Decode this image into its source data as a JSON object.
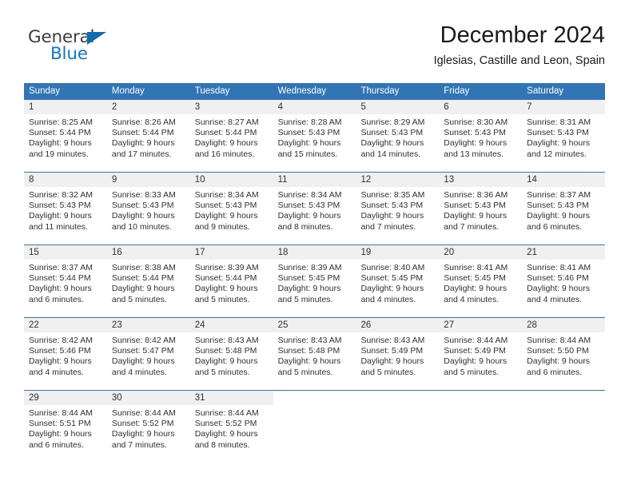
{
  "logo": {
    "word_top": "General",
    "word_bottom": "Blue",
    "triangle_color": "#0f6bb0",
    "top_color": "#3d3d3d",
    "bottom_color": "#1178c6"
  },
  "header": {
    "title": "December 2024",
    "subtitle": "Iglesias, Castille and Leon, Spain"
  },
  "theme": {
    "header_blue": "#3175b5",
    "day_band_gray": "#f0f0f0",
    "text": "#303030"
  },
  "weekdays": [
    "Sunday",
    "Monday",
    "Tuesday",
    "Wednesday",
    "Thursday",
    "Friday",
    "Saturday"
  ],
  "weeks": [
    [
      {
        "day": "1",
        "sunrise": "Sunrise: 8:25 AM",
        "sunset": "Sunset: 5:44 PM",
        "daylight1": "Daylight: 9 hours",
        "daylight2": "and 19 minutes."
      },
      {
        "day": "2",
        "sunrise": "Sunrise: 8:26 AM",
        "sunset": "Sunset: 5:44 PM",
        "daylight1": "Daylight: 9 hours",
        "daylight2": "and 17 minutes."
      },
      {
        "day": "3",
        "sunrise": "Sunrise: 8:27 AM",
        "sunset": "Sunset: 5:44 PM",
        "daylight1": "Daylight: 9 hours",
        "daylight2": "and 16 minutes."
      },
      {
        "day": "4",
        "sunrise": "Sunrise: 8:28 AM",
        "sunset": "Sunset: 5:43 PM",
        "daylight1": "Daylight: 9 hours",
        "daylight2": "and 15 minutes."
      },
      {
        "day": "5",
        "sunrise": "Sunrise: 8:29 AM",
        "sunset": "Sunset: 5:43 PM",
        "daylight1": "Daylight: 9 hours",
        "daylight2": "and 14 minutes."
      },
      {
        "day": "6",
        "sunrise": "Sunrise: 8:30 AM",
        "sunset": "Sunset: 5:43 PM",
        "daylight1": "Daylight: 9 hours",
        "daylight2": "and 13 minutes."
      },
      {
        "day": "7",
        "sunrise": "Sunrise: 8:31 AM",
        "sunset": "Sunset: 5:43 PM",
        "daylight1": "Daylight: 9 hours",
        "daylight2": "and 12 minutes."
      }
    ],
    [
      {
        "day": "8",
        "sunrise": "Sunrise: 8:32 AM",
        "sunset": "Sunset: 5:43 PM",
        "daylight1": "Daylight: 9 hours",
        "daylight2": "and 11 minutes."
      },
      {
        "day": "9",
        "sunrise": "Sunrise: 8:33 AM",
        "sunset": "Sunset: 5:43 PM",
        "daylight1": "Daylight: 9 hours",
        "daylight2": "and 10 minutes."
      },
      {
        "day": "10",
        "sunrise": "Sunrise: 8:34 AM",
        "sunset": "Sunset: 5:43 PM",
        "daylight1": "Daylight: 9 hours",
        "daylight2": "and 9 minutes."
      },
      {
        "day": "11",
        "sunrise": "Sunrise: 8:34 AM",
        "sunset": "Sunset: 5:43 PM",
        "daylight1": "Daylight: 9 hours",
        "daylight2": "and 8 minutes."
      },
      {
        "day": "12",
        "sunrise": "Sunrise: 8:35 AM",
        "sunset": "Sunset: 5:43 PM",
        "daylight1": "Daylight: 9 hours",
        "daylight2": "and 7 minutes."
      },
      {
        "day": "13",
        "sunrise": "Sunrise: 8:36 AM",
        "sunset": "Sunset: 5:43 PM",
        "daylight1": "Daylight: 9 hours",
        "daylight2": "and 7 minutes."
      },
      {
        "day": "14",
        "sunrise": "Sunrise: 8:37 AM",
        "sunset": "Sunset: 5:43 PM",
        "daylight1": "Daylight: 9 hours",
        "daylight2": "and 6 minutes."
      }
    ],
    [
      {
        "day": "15",
        "sunrise": "Sunrise: 8:37 AM",
        "sunset": "Sunset: 5:44 PM",
        "daylight1": "Daylight: 9 hours",
        "daylight2": "and 6 minutes."
      },
      {
        "day": "16",
        "sunrise": "Sunrise: 8:38 AM",
        "sunset": "Sunset: 5:44 PM",
        "daylight1": "Daylight: 9 hours",
        "daylight2": "and 5 minutes."
      },
      {
        "day": "17",
        "sunrise": "Sunrise: 8:39 AM",
        "sunset": "Sunset: 5:44 PM",
        "daylight1": "Daylight: 9 hours",
        "daylight2": "and 5 minutes."
      },
      {
        "day": "18",
        "sunrise": "Sunrise: 8:39 AM",
        "sunset": "Sunset: 5:45 PM",
        "daylight1": "Daylight: 9 hours",
        "daylight2": "and 5 minutes."
      },
      {
        "day": "19",
        "sunrise": "Sunrise: 8:40 AM",
        "sunset": "Sunset: 5:45 PM",
        "daylight1": "Daylight: 9 hours",
        "daylight2": "and 4 minutes."
      },
      {
        "day": "20",
        "sunrise": "Sunrise: 8:41 AM",
        "sunset": "Sunset: 5:45 PM",
        "daylight1": "Daylight: 9 hours",
        "daylight2": "and 4 minutes."
      },
      {
        "day": "21",
        "sunrise": "Sunrise: 8:41 AM",
        "sunset": "Sunset: 5:46 PM",
        "daylight1": "Daylight: 9 hours",
        "daylight2": "and 4 minutes."
      }
    ],
    [
      {
        "day": "22",
        "sunrise": "Sunrise: 8:42 AM",
        "sunset": "Sunset: 5:46 PM",
        "daylight1": "Daylight: 9 hours",
        "daylight2": "and 4 minutes."
      },
      {
        "day": "23",
        "sunrise": "Sunrise: 8:42 AM",
        "sunset": "Sunset: 5:47 PM",
        "daylight1": "Daylight: 9 hours",
        "daylight2": "and 4 minutes."
      },
      {
        "day": "24",
        "sunrise": "Sunrise: 8:43 AM",
        "sunset": "Sunset: 5:48 PM",
        "daylight1": "Daylight: 9 hours",
        "daylight2": "and 5 minutes."
      },
      {
        "day": "25",
        "sunrise": "Sunrise: 8:43 AM",
        "sunset": "Sunset: 5:48 PM",
        "daylight1": "Daylight: 9 hours",
        "daylight2": "and 5 minutes."
      },
      {
        "day": "26",
        "sunrise": "Sunrise: 8:43 AM",
        "sunset": "Sunset: 5:49 PM",
        "daylight1": "Daylight: 9 hours",
        "daylight2": "and 5 minutes."
      },
      {
        "day": "27",
        "sunrise": "Sunrise: 8:44 AM",
        "sunset": "Sunset: 5:49 PM",
        "daylight1": "Daylight: 9 hours",
        "daylight2": "and 5 minutes."
      },
      {
        "day": "28",
        "sunrise": "Sunrise: 8:44 AM",
        "sunset": "Sunset: 5:50 PM",
        "daylight1": "Daylight: 9 hours",
        "daylight2": "and 6 minutes."
      }
    ],
    [
      {
        "day": "29",
        "sunrise": "Sunrise: 8:44 AM",
        "sunset": "Sunset: 5:51 PM",
        "daylight1": "Daylight: 9 hours",
        "daylight2": "and 6 minutes."
      },
      {
        "day": "30",
        "sunrise": "Sunrise: 8:44 AM",
        "sunset": "Sunset: 5:52 PM",
        "daylight1": "Daylight: 9 hours",
        "daylight2": "and 7 minutes."
      },
      {
        "day": "31",
        "sunrise": "Sunrise: 8:44 AM",
        "sunset": "Sunset: 5:52 PM",
        "daylight1": "Daylight: 9 hours",
        "daylight2": "and 8 minutes."
      },
      {
        "day": "",
        "sunrise": "",
        "sunset": "",
        "daylight1": "",
        "daylight2": ""
      },
      {
        "day": "",
        "sunrise": "",
        "sunset": "",
        "daylight1": "",
        "daylight2": ""
      },
      {
        "day": "",
        "sunrise": "",
        "sunset": "",
        "daylight1": "",
        "daylight2": ""
      },
      {
        "day": "",
        "sunrise": "",
        "sunset": "",
        "daylight1": "",
        "daylight2": ""
      }
    ]
  ]
}
